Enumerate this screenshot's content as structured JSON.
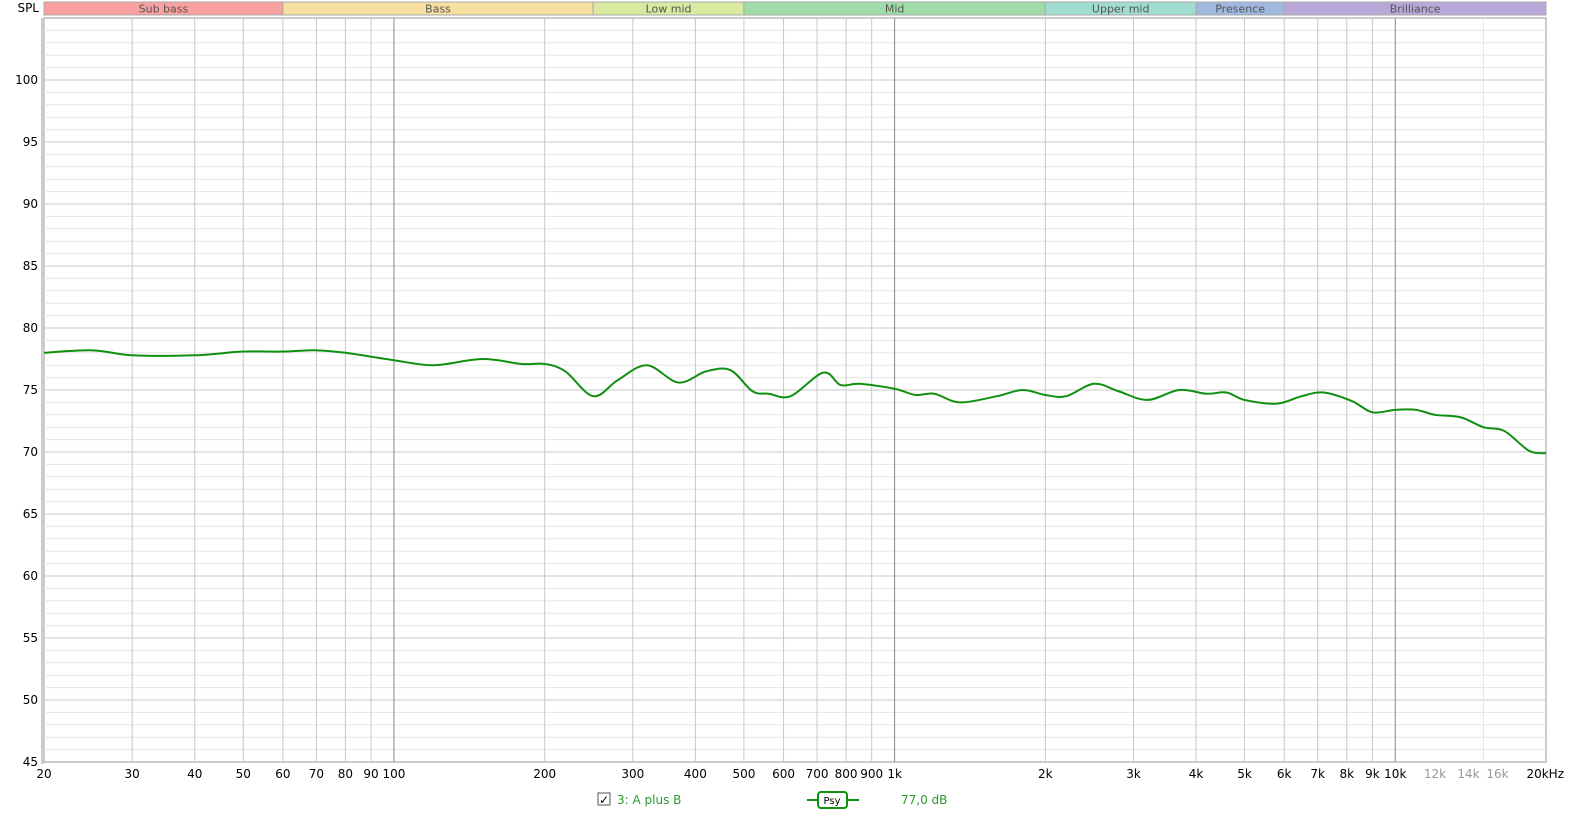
{
  "chart_data": {
    "type": "line",
    "title": "",
    "ylabel": "SPL",
    "xlabel": "",
    "x_scale": "log",
    "xlim": [
      20,
      20000
    ],
    "ylim": [
      45,
      105
    ],
    "grid": true,
    "y_ticks": [
      45,
      50,
      55,
      60,
      65,
      70,
      75,
      80,
      85,
      90,
      95,
      100
    ],
    "x_ticks": [
      {
        "v": 20,
        "label": "20"
      },
      {
        "v": 30,
        "label": "30"
      },
      {
        "v": 40,
        "label": "40"
      },
      {
        "v": 50,
        "label": "50"
      },
      {
        "v": 60,
        "label": "60"
      },
      {
        "v": 70,
        "label": "70"
      },
      {
        "v": 80,
        "label": "80"
      },
      {
        "v": 90,
        "label": "90"
      },
      {
        "v": 100,
        "label": "100"
      },
      {
        "v": 200,
        "label": "200"
      },
      {
        "v": 300,
        "label": "300"
      },
      {
        "v": 400,
        "label": "400"
      },
      {
        "v": 500,
        "label": "500"
      },
      {
        "v": 600,
        "label": "600"
      },
      {
        "v": 700,
        "label": "700"
      },
      {
        "v": 800,
        "label": "800"
      },
      {
        "v": 900,
        "label": "900"
      },
      {
        "v": 1000,
        "label": "1k"
      },
      {
        "v": 2000,
        "label": "2k"
      },
      {
        "v": 3000,
        "label": "3k"
      },
      {
        "v": 4000,
        "label": "4k"
      },
      {
        "v": 5000,
        "label": "5k"
      },
      {
        "v": 6000,
        "label": "6k"
      },
      {
        "v": 7000,
        "label": "7k"
      },
      {
        "v": 8000,
        "label": "8k"
      },
      {
        "v": 9000,
        "label": "9k"
      },
      {
        "v": 10000,
        "label": "10k"
      },
      {
        "v": 12000,
        "label": "12k",
        "muted": true
      },
      {
        "v": 14000,
        "label": "14k",
        "muted": true
      },
      {
        "v": 16000,
        "label": "16k",
        "muted": true
      },
      {
        "v": 20000,
        "label": "20kHz"
      }
    ],
    "bands": [
      {
        "name": "Sub bass",
        "from": 20,
        "to": 60,
        "color": "#f9a0a0"
      },
      {
        "name": "Bass",
        "from": 60,
        "to": 250,
        "color": "#f7e0a0"
      },
      {
        "name": "Low mid",
        "from": 250,
        "to": 500,
        "color": "#d8eaa0"
      },
      {
        "name": "Mid",
        "from": 500,
        "to": 2000,
        "color": "#a0dca8"
      },
      {
        "name": "Upper mid",
        "from": 2000,
        "to": 4000,
        "color": "#a0dcd0"
      },
      {
        "name": "Presence",
        "from": 4000,
        "to": 6000,
        "color": "#a0b8e0"
      },
      {
        "name": "Brilliance",
        "from": 6000,
        "to": 20000,
        "color": "#b8a8d8"
      }
    ],
    "series": [
      {
        "name": "3: A plus B",
        "color": "#109010",
        "smoothing": "Psy",
        "level": "77,0 dB",
        "checked": true,
        "points": [
          [
            20,
            78.0
          ],
          [
            25,
            78.2
          ],
          [
            30,
            77.8
          ],
          [
            40,
            77.8
          ],
          [
            50,
            78.1
          ],
          [
            60,
            78.1
          ],
          [
            70,
            78.2
          ],
          [
            80,
            78.0
          ],
          [
            100,
            77.4
          ],
          [
            120,
            77.0
          ],
          [
            150,
            77.5
          ],
          [
            180,
            77.1
          ],
          [
            200,
            77.1
          ],
          [
            220,
            76.5
          ],
          [
            250,
            74.5
          ],
          [
            280,
            75.8
          ],
          [
            320,
            77.0
          ],
          [
            370,
            75.6
          ],
          [
            420,
            76.5
          ],
          [
            470,
            76.6
          ],
          [
            520,
            74.9
          ],
          [
            560,
            74.7
          ],
          [
            620,
            74.5
          ],
          [
            720,
            76.4
          ],
          [
            780,
            75.4
          ],
          [
            850,
            75.5
          ],
          [
            1000,
            75.1
          ],
          [
            1100,
            74.6
          ],
          [
            1200,
            74.7
          ],
          [
            1350,
            74.0
          ],
          [
            1600,
            74.5
          ],
          [
            1800,
            75.0
          ],
          [
            2000,
            74.6
          ],
          [
            2200,
            74.5
          ],
          [
            2500,
            75.5
          ],
          [
            2800,
            74.9
          ],
          [
            3200,
            74.2
          ],
          [
            3700,
            75.0
          ],
          [
            4200,
            74.7
          ],
          [
            4600,
            74.8
          ],
          [
            5000,
            74.2
          ],
          [
            5800,
            73.9
          ],
          [
            6500,
            74.5
          ],
          [
            7200,
            74.8
          ],
          [
            8200,
            74.1
          ],
          [
            9000,
            73.2
          ],
          [
            10000,
            73.4
          ],
          [
            11000,
            73.4
          ],
          [
            12000,
            73.0
          ],
          [
            13500,
            72.8
          ],
          [
            15000,
            72.0
          ],
          [
            16500,
            71.7
          ],
          [
            18500,
            70.1
          ],
          [
            20000,
            69.9
          ]
        ]
      }
    ]
  }
}
